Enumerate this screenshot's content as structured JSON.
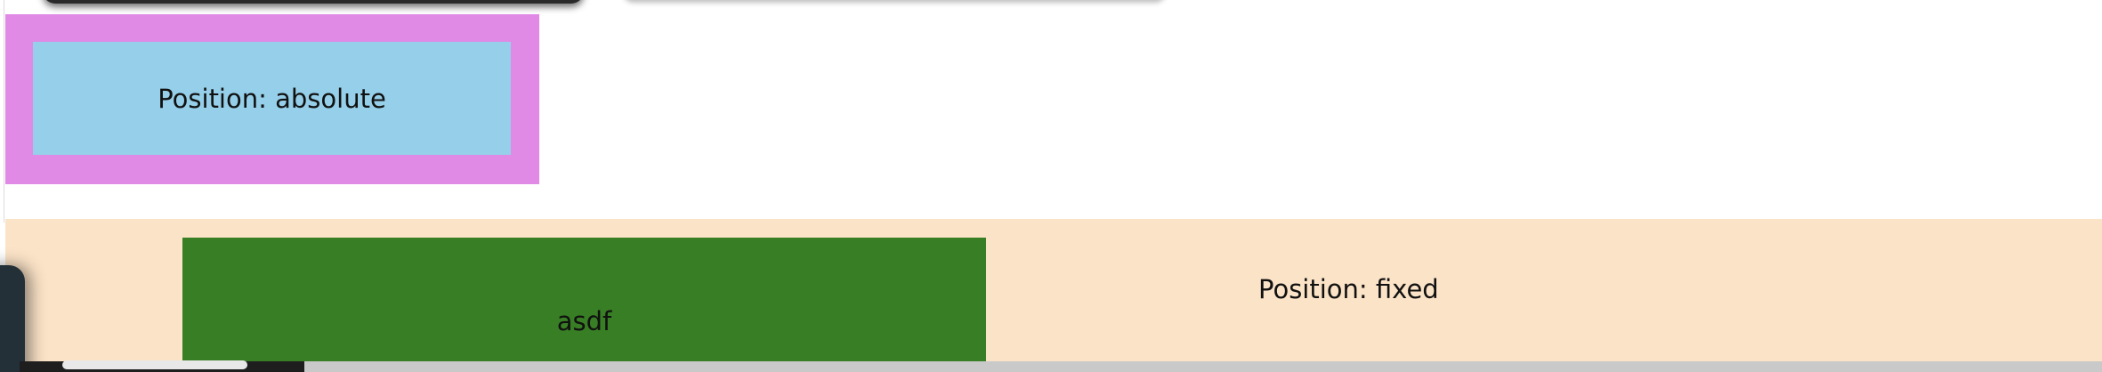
{
  "absolute_box": {
    "label": "Position: absolute"
  },
  "fixed_bar": {
    "label": "Position: fixed",
    "inner_box_label": "asdf"
  },
  "colors": {
    "absolute_outer": "#e08ae6",
    "absolute_inner": "#96cfe9",
    "fixed_background": "#fbe3c7",
    "green_box": "#387e24"
  }
}
